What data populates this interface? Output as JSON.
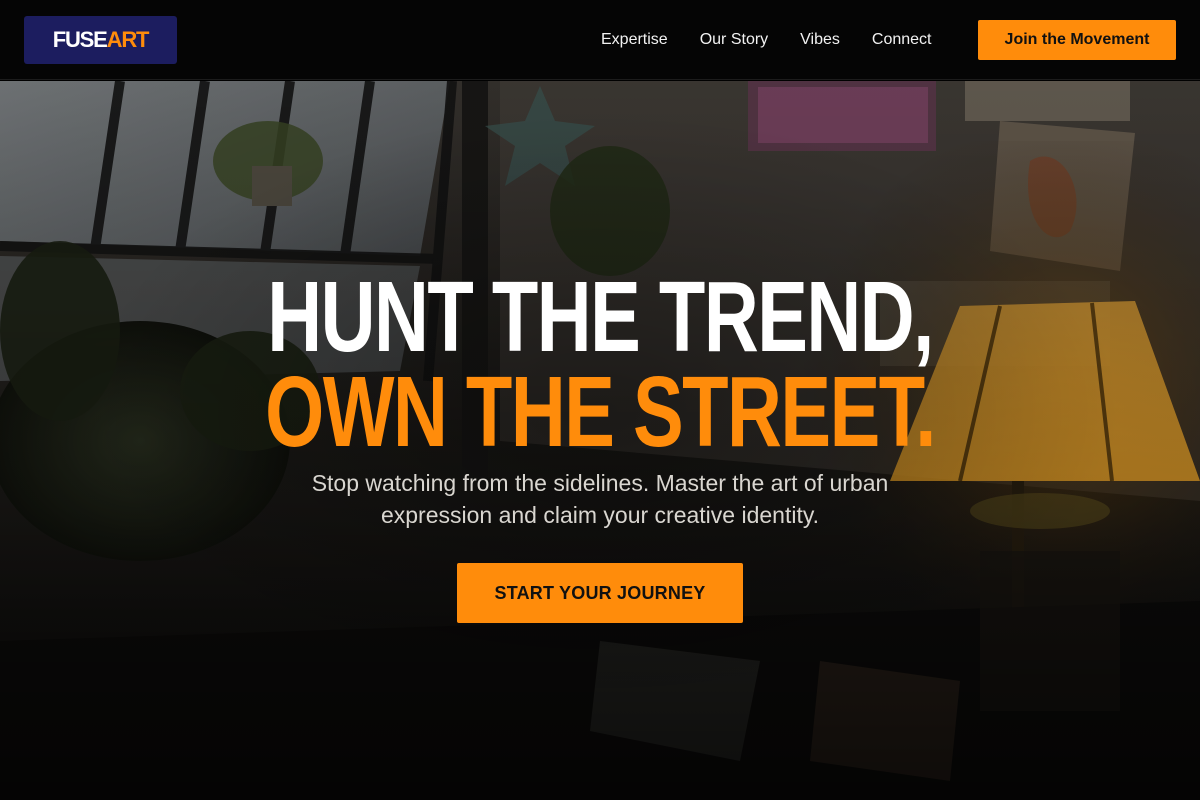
{
  "brand": {
    "logo_part1": "FUSE",
    "logo_part2": "ART"
  },
  "nav": {
    "links": [
      {
        "label": "Expertise"
      },
      {
        "label": "Our Story"
      },
      {
        "label": "Vibes"
      },
      {
        "label": "Connect"
      }
    ],
    "cta_label": "Join the Movement"
  },
  "hero": {
    "headline_line1": "HUNT THE TREND,",
    "headline_line2": "OWN THE STREET.",
    "subtitle": "Stop watching from the sidelines. Master the art of urban expression and claim your creative identity.",
    "cta_label": "START YOUR JOURNEY"
  },
  "colors": {
    "accent": "#ff8c0b",
    "logo_bg": "#1c1d5f",
    "nav_bg": "#050505",
    "text_light": "#ffffff"
  },
  "icons": {
    "hero_background": "studio-photo-image"
  }
}
